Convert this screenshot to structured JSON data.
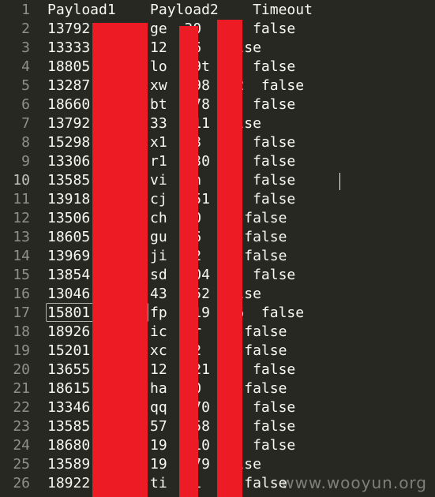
{
  "lines": [
    {
      "num": "1",
      "text": "Payload1    Payload2    Timeout"
    },
    {
      "num": "2",
      "text": "13792       ge  30   0  false"
    },
    {
      "num": "3",
      "text": "13333     3 12  56  false"
    },
    {
      "num": "4",
      "text": "18805       lo   9t  i  false"
    },
    {
      "num": "5",
      "text": "13287     7 xw   98  22  false"
    },
    {
      "num": "6",
      "text": "18660     3 bt   78  9  false"
    },
    {
      "num": "7",
      "text": "13792     3 33   11 false"
    },
    {
      "num": "8",
      "text": "15298     0 x1  e3  n5  false"
    },
    {
      "num": "9",
      "text": "13306     3 r1   30     false"
    },
    {
      "num": "10",
      "text": "13585     0 vi  an  30  false"
    },
    {
      "num": "11",
      "text": "13918     3 cj   51  3  false"
    },
    {
      "num": "12",
      "text": "13506     3 ch  n0  4  false"
    },
    {
      "num": "13",
      "text": "18605     3 gu  u6     false"
    },
    {
      "num": "14",
      "text": "13969     0 ji  i2  4  false"
    },
    {
      "num": "15",
      "text": "13854     3 sd   04     false"
    },
    {
      "num": "16",
      "text": "13046     3 43   52 false"
    },
    {
      "num": "17",
      "text": "15801     0 fp   19  56  false"
    },
    {
      "num": "18",
      "text": "18926     0 ic  6r  n  false"
    },
    {
      "num": "19",
      "text": "15201     3 xc  p2  4  false"
    },
    {
      "num": "20",
      "text": "13655     0 12   21     false"
    },
    {
      "num": "21",
      "text": "18615     2 ha  s0     false"
    },
    {
      "num": "22",
      "text": "13346     5 qq   70  5  false"
    },
    {
      "num": "23",
      "text": "13585     0 57   58  o  false"
    },
    {
      "num": "24",
      "text": "18680     3 19   10  a  false"
    },
    {
      "num": "25",
      "text": "13589     3 19   79 false"
    },
    {
      "num": "26",
      "text": "18922     7 ti  ti     false"
    }
  ],
  "watermark": "www.wooyun.org",
  "colors": {
    "background": "#272822",
    "text": "#f8f8f2",
    "line_number": "#90908a",
    "redaction": "#ed1c24"
  }
}
